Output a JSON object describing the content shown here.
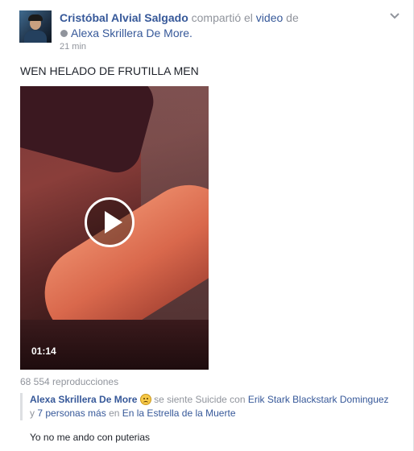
{
  "post": {
    "author": "Cristóbal Alvial Salgado",
    "action_text": " compartió el ",
    "video_link": "video",
    "of_text": " de",
    "original_author": "Alexa Skrillera De More.",
    "time": "21 min",
    "text": "WEN HELADO DE FRUTILLA MEN"
  },
  "video": {
    "duration": "01:14",
    "views": "68 554 reproducciones"
  },
  "shared": {
    "author": "Alexa Skrillera De More",
    "feeling_text": " se siente Suicide con ",
    "tagged_person": "Erik Stark Blackstark Dominguez",
    "and_text": "y ",
    "others_link": "7 personas más",
    "at_text": " en ",
    "place": "En la Estrella de la Muerte",
    "comment": "Yo no me ando con puterias"
  },
  "icons": {
    "menu": "chevron-down-icon",
    "privacy": "globe-icon",
    "play": "play-icon",
    "feeling": "sad-emoji-icon"
  },
  "colors": {
    "link": "#365899",
    "meta": "#90949c",
    "background": "#e9ebee"
  }
}
